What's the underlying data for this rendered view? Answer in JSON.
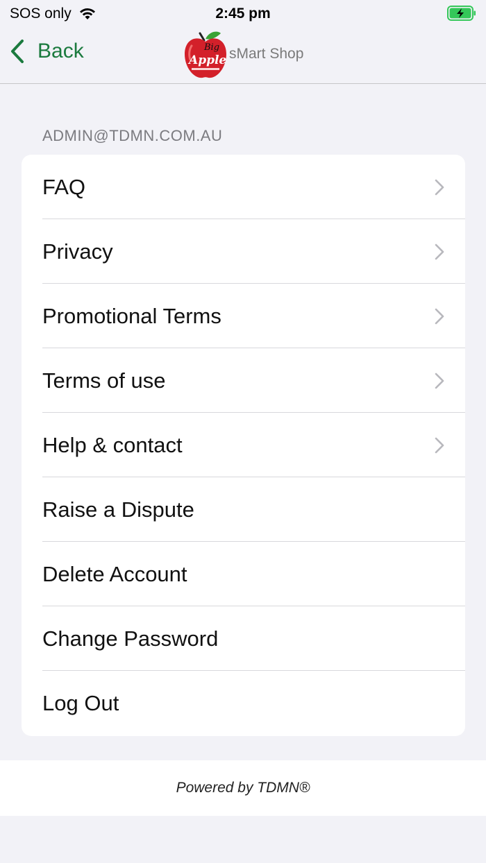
{
  "status_bar": {
    "carrier": "SOS only",
    "time": "2:45 pm",
    "wifi_icon": "wifi-icon",
    "battery_icon": "battery-charging-icon"
  },
  "nav": {
    "back_label": "Back",
    "back_icon": "chevron-left-icon",
    "brand_name": "sMart Shop",
    "logo_text_top": "Big",
    "logo_text_main": "Apple",
    "accent_color": "#1b7a3e"
  },
  "account": {
    "email": "ADMIN@TDMN.COM.AU"
  },
  "menu": {
    "items": [
      {
        "label": "FAQ",
        "has_chevron": true
      },
      {
        "label": "Privacy",
        "has_chevron": true
      },
      {
        "label": "Promotional Terms",
        "has_chevron": true
      },
      {
        "label": "Terms of use",
        "has_chevron": true
      },
      {
        "label": "Help & contact",
        "has_chevron": true
      },
      {
        "label": "Raise a Dispute",
        "has_chevron": false
      },
      {
        "label": "Delete Account",
        "has_chevron": false
      },
      {
        "label": "Change Password",
        "has_chevron": false
      },
      {
        "label": "Log Out",
        "has_chevron": false
      }
    ]
  },
  "footer": {
    "powered_by": "Powered by TDMN®"
  }
}
